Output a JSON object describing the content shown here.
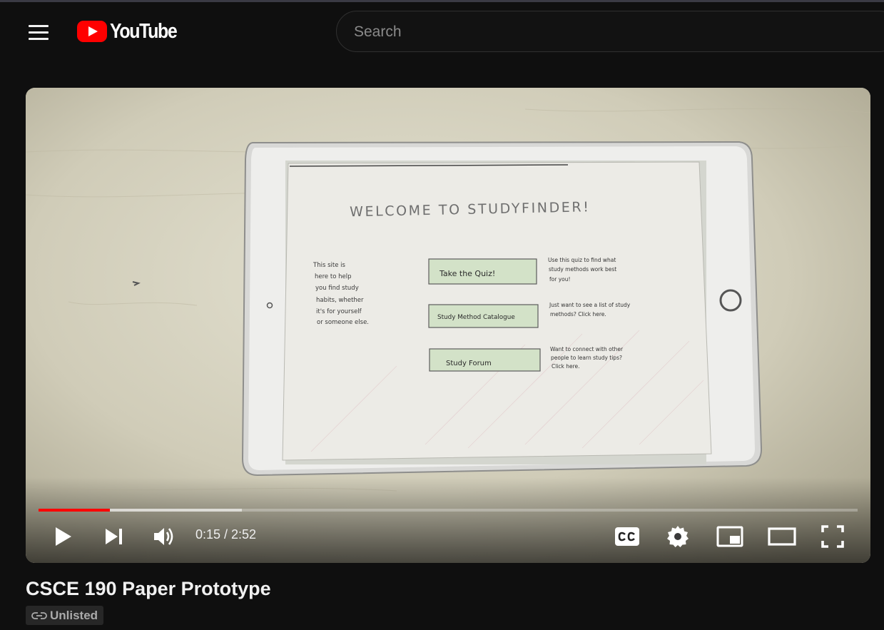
{
  "masthead": {
    "logo_text": "YouTube",
    "search_placeholder": "Search"
  },
  "video": {
    "frame": {
      "heading": "WELCOME TO STUDYFINDER!",
      "intro_lines": [
        "This site is",
        "here to help",
        "you find study",
        "habits, whether",
        "it's for yourself",
        "or someone else."
      ],
      "buttons": [
        {
          "label": "Take the Quiz!",
          "desc_lines": [
            "Use this quiz to find what",
            "study methods work best",
            "for you!"
          ]
        },
        {
          "label": "Study Method Catalogue",
          "desc_lines": [
            "Just want to see a list of study",
            "methods? Click here."
          ]
        },
        {
          "label": "Study Forum",
          "desc_lines": [
            "Want to connect with other",
            "people to learn study tips?",
            "Click here."
          ]
        }
      ]
    }
  },
  "player": {
    "current_time": "0:15",
    "duration": "2:52",
    "time_display": "0:15 / 2:52",
    "played_fraction": 0.087,
    "buffered_fraction": 0.248
  },
  "info": {
    "title": "CSCE 190 Paper Prototype",
    "visibility": "Unlisted"
  },
  "icons": {
    "menu": "hamburger-menu-icon",
    "play": "play-icon",
    "next": "next-icon",
    "volume": "volume-icon",
    "captions": "captions-icon",
    "settings": "gear-icon",
    "miniplayer": "miniplayer-icon",
    "theater": "theater-mode-icon",
    "fullscreen": "fullscreen-icon",
    "link": "link-icon"
  },
  "colors": {
    "background": "#0f0f0f",
    "brand_red": "#ff0000",
    "progress_played": "#ff0000",
    "text": "#f1f1f1"
  }
}
